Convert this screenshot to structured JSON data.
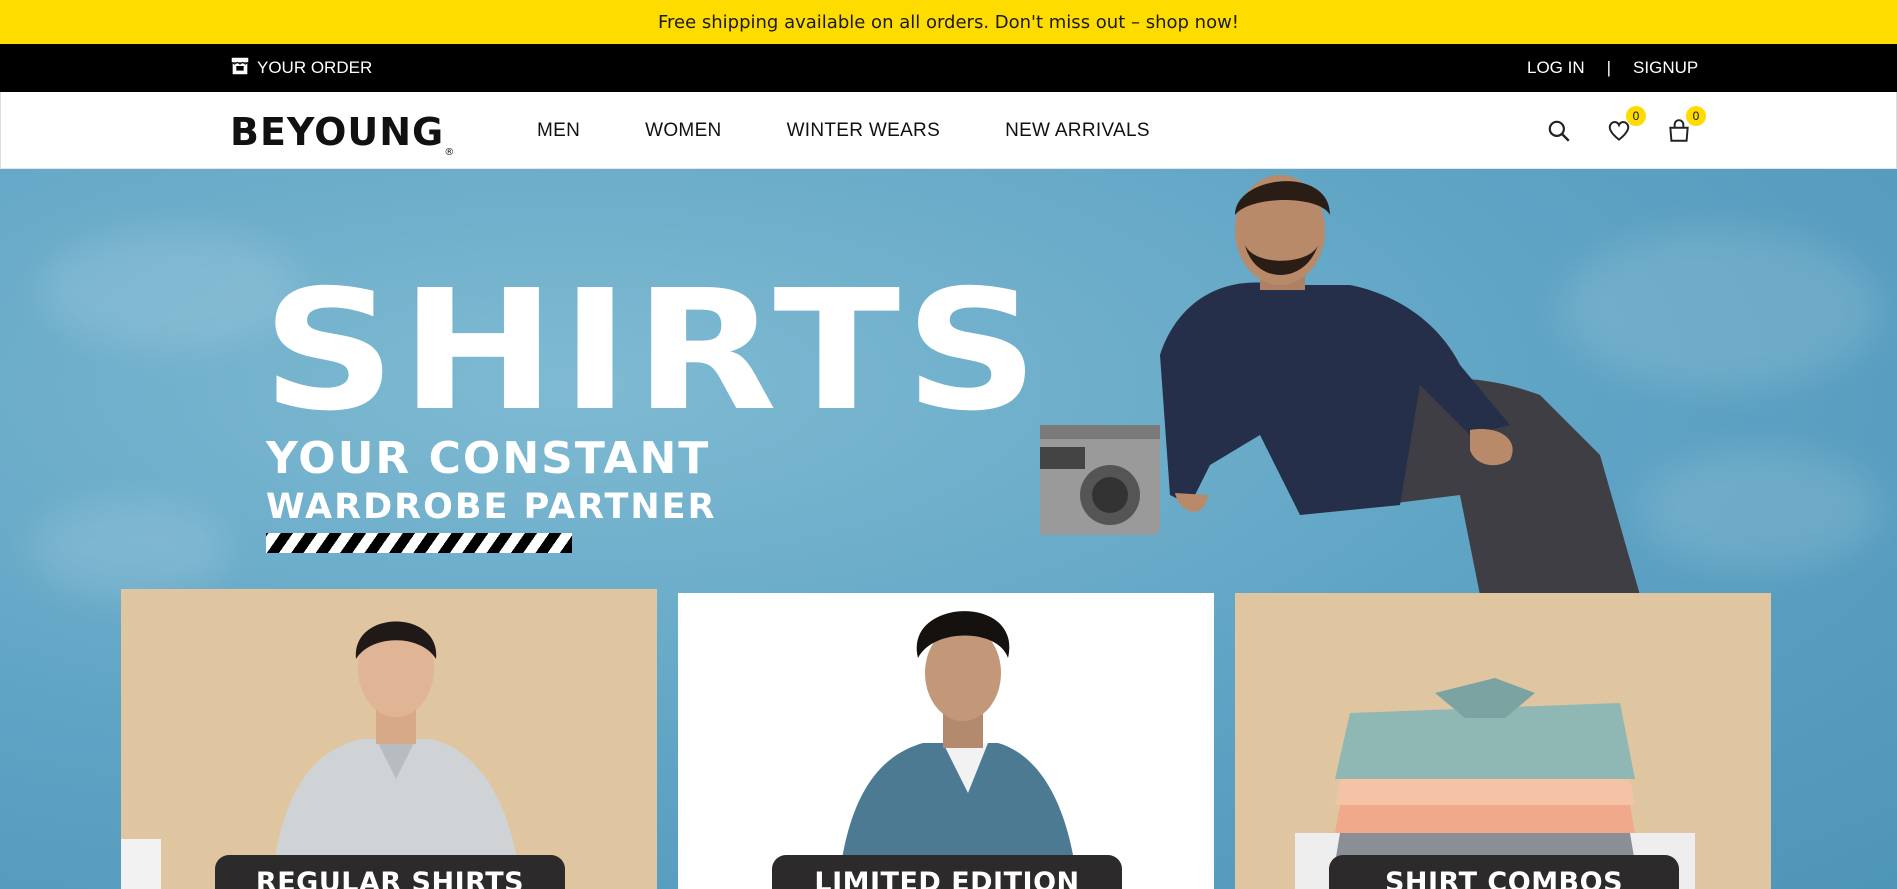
{
  "announcement": "Free shipping available on all orders. Don't miss out – shop now!",
  "topbar": {
    "order_label": "YOUR ORDER",
    "order_icon": "store-icon",
    "login": "LOG IN",
    "separator": "|",
    "signup": "SIGNUP"
  },
  "header": {
    "logo": "BEYOUNG",
    "logo_mark": "®",
    "nav": [
      "MEN",
      "WOMEN",
      "WINTER WEARS",
      "NEW ARRIVALS"
    ],
    "wishlist_count": "0",
    "cart_count": "0"
  },
  "hero": {
    "title": "SHIRTS",
    "subtitle_line1": "YOUR CONSTANT",
    "subtitle_line2": "WARDROBE PARTNER"
  },
  "cards": [
    {
      "label": "REGULAR SHIRTS",
      "bg": "#dfc6a0"
    },
    {
      "label": "LIMITED EDITION",
      "bg": "#ffffff"
    },
    {
      "label": "SHIRT COMBOS",
      "bg": "#dfc6a0"
    }
  ],
  "colors": {
    "accent": "#fedc00",
    "black": "#000000",
    "hero_bg": "#6fb0cc"
  }
}
